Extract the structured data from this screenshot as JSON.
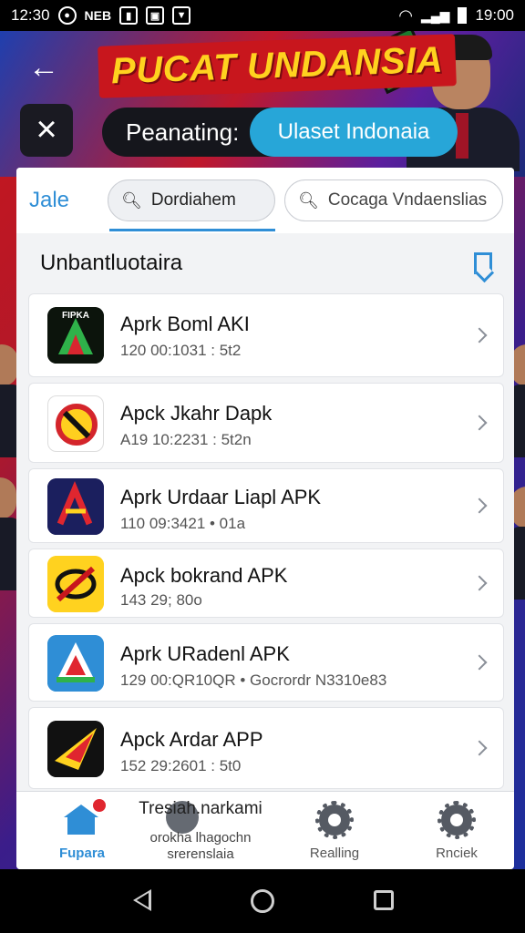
{
  "status_bar": {
    "time_left": "12:30",
    "carrier_text": "NEB",
    "time_right": "19:00"
  },
  "banner": {
    "title": "PUCAT UNDANSIA",
    "label": "Peanating:",
    "value": "Ulaset Indonaia"
  },
  "search": {
    "tab_label": "Jale",
    "active_query": "Dordiahem",
    "second_query": "Cocaga Vndaenslias"
  },
  "section": {
    "title": "Unbantluotaira"
  },
  "apps": [
    {
      "name": "Aprk Boml AKI",
      "meta": "120 00:1031 : 5t2"
    },
    {
      "name": "Apck Jkahr Dapk",
      "meta": "A19 10:2231 : 5t2n"
    },
    {
      "name": "Aprk Urdaar Liapl APK",
      "meta": "110 09:3421 • 01a"
    },
    {
      "name": "Apck bokrand APK",
      "meta": "143 29; 80o"
    },
    {
      "name": "Aprk URadenl APK",
      "meta": "129 00:QR10QR • Gocrordr N3310e83"
    },
    {
      "name": "Apck Ardar APP",
      "meta": "152 29:2601 : 5t0"
    }
  ],
  "bottom_nav": {
    "home_label": "Fupara",
    "middle_title": "Tresiah.narkami",
    "middle_sub1": "orokha lhagochn",
    "middle_sub2": "srerenslaia",
    "item3_label": "Realling",
    "item4_label": "Rnciek"
  },
  "colors": {
    "accent": "#2f8ed6",
    "banner_red": "#c8161d",
    "banner_yellow": "#ffd21f",
    "pill_value": "#27a6d8"
  },
  "icons": [
    "back-arrow-icon",
    "close-icon",
    "search-icon",
    "bookmark-icon",
    "chevron-right-icon",
    "home-icon",
    "gear-icon",
    "wifi-icon",
    "battery-icon"
  ]
}
